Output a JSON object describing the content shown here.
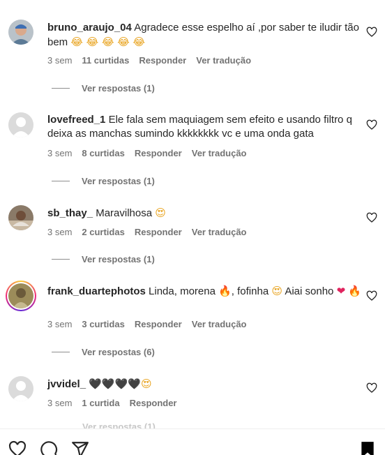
{
  "comments": [
    {
      "username": "bruno_araujo_04",
      "text": "Agradece esse espelho aí ,por saber te iludir tão bem",
      "emojis": "😂 😂 😂 😂 😂",
      "time": "3 sem",
      "likes": "11 curtidas",
      "reply_label": "Responder",
      "translate_label": "Ver tradução",
      "view_replies": "Ver respostas (1)"
    },
    {
      "username": "lovefreed_1",
      "text": "Ele fala sem maquiagem sem efeito e usando filtro q deixa as manchas sumindo kkkkkkkk vc e uma onda gata",
      "time": "3 sem",
      "likes": "8 curtidas",
      "reply_label": "Responder",
      "translate_label": "Ver tradução",
      "view_replies": "Ver respostas (1)"
    },
    {
      "username": "sb_thay_",
      "text": "Maravilhosa",
      "emojis": "😍",
      "time": "3 sem",
      "likes": "2 curtidas",
      "reply_label": "Responder",
      "translate_label": "Ver tradução",
      "view_replies": "Ver respostas (1)"
    },
    {
      "username": "frank_duartephotos",
      "text_a": "Linda, morena",
      "emoji_fire": "🔥",
      "text_b": ", fofinha",
      "emoji_love": "😍",
      "text_c": "Aiai sonho",
      "emoji_heart": "❤",
      "time": "3 sem",
      "likes": "3 curtidas",
      "reply_label": "Responder",
      "translate_label": "Ver tradução",
      "view_replies": "Ver respostas (6)"
    },
    {
      "username": "jvvidel_",
      "emojis": "🖤🖤🖤🖤",
      "emoji_love": "😍",
      "time": "3 sem",
      "likes": "1 curtida",
      "reply_label": "Responder",
      "view_replies": "Ver respostas (1)"
    }
  ],
  "icons": {
    "like": "heart-outline-icon",
    "bottom_like": "heart-outline-icon",
    "comment": "comment-bubble-icon",
    "share": "paper-plane-icon",
    "save": "bookmark-filled-icon"
  }
}
